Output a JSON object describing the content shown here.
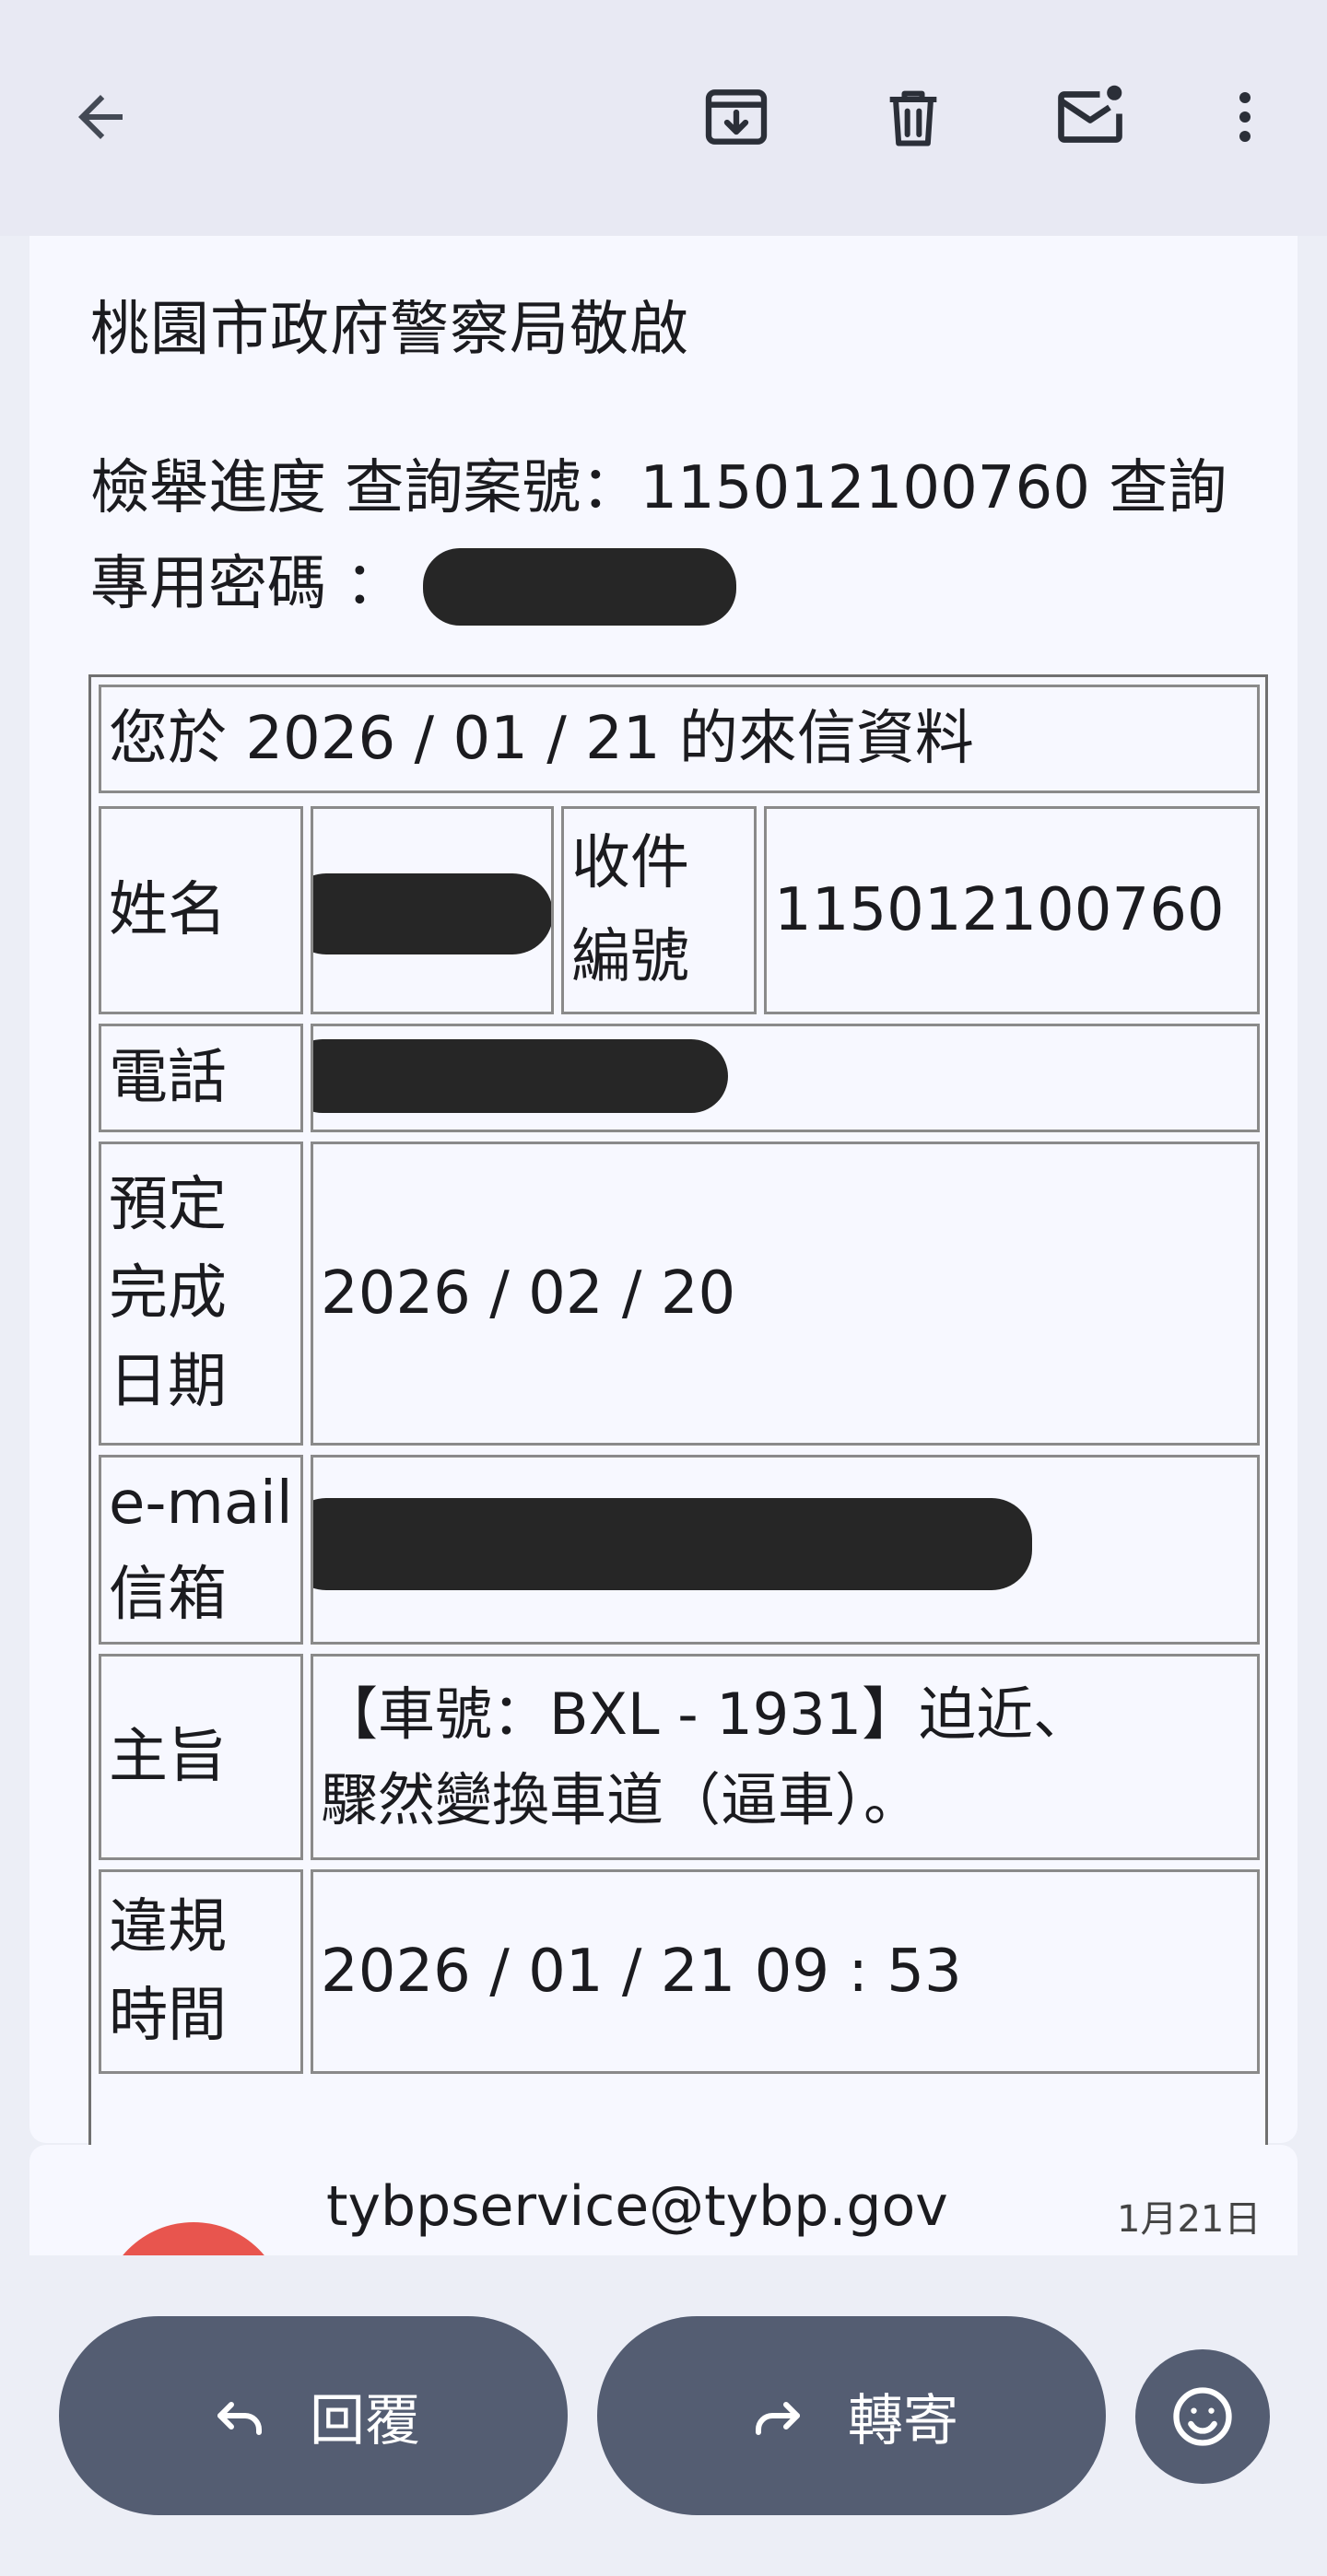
{
  "toolbar": {
    "back_icon": "arrow-back-icon",
    "archive_icon": "archive-icon",
    "delete_icon": "trash-icon",
    "unread_icon": "mark-unread-icon",
    "more_icon": "more-vert-icon"
  },
  "email": {
    "greeting": "桃園市政府警察局敬啟",
    "progress_text": "檢舉進度 查詢案號：115012100760 查詢專用密碼 ：",
    "table": {
      "header": "您於 2026 / 01 / 21 的來信資料",
      "name_label": "姓名",
      "receipt_label": "收件\n編號",
      "receipt_value": "115012100760",
      "phone_label": "電話",
      "due_label": "預定\n完成\n日期",
      "due_value": "2026 / 02 / 20",
      "email_label": "e-mail\n信箱",
      "subject_label": "主旨",
      "subject_value": "【車號：BXL - 1931】迫近、\n驟然變換車道（逼車）。",
      "violation_label": "違規\n時間",
      "violation_value": "2026 / 01 / 21 09 : 53"
    }
  },
  "next_message": {
    "from": "tybpservice@tybp.gov",
    "date": "1月21日"
  },
  "actions": {
    "reply_label": "回覆",
    "forward_label": "轉寄",
    "reply_icon": "reply-icon",
    "forward_icon": "forward-icon",
    "emoji_icon": "emoji-icon"
  },
  "colors": {
    "accent_button": "#545d72",
    "avatar": "#e8554e"
  }
}
